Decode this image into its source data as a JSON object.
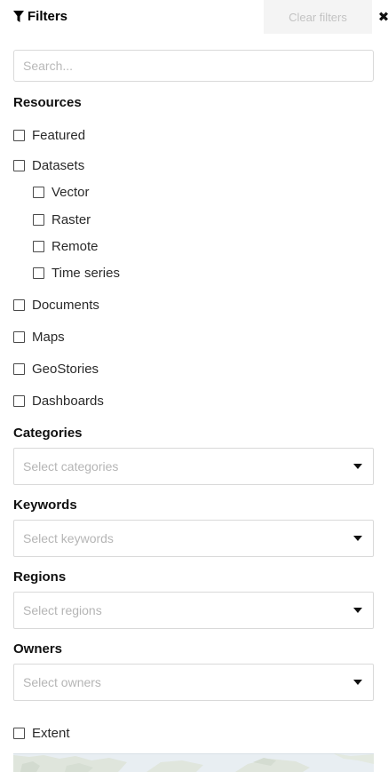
{
  "header": {
    "title": "Filters",
    "clear_label": "Clear filters",
    "close_icon": "close-icon"
  },
  "search": {
    "placeholder": "Search..."
  },
  "resources": {
    "title": "Resources",
    "items": [
      {
        "label": "Featured",
        "checked": false
      },
      {
        "label": "Datasets",
        "checked": false
      },
      {
        "label": "Vector",
        "checked": false
      },
      {
        "label": "Raster",
        "checked": false
      },
      {
        "label": "Remote",
        "checked": false
      },
      {
        "label": "Time series",
        "checked": false
      },
      {
        "label": "Documents",
        "checked": false
      },
      {
        "label": "Maps",
        "checked": false
      },
      {
        "label": "GeoStories",
        "checked": false
      },
      {
        "label": "Dashboards",
        "checked": false
      }
    ]
  },
  "categories": {
    "title": "Categories",
    "placeholder": "Select categories"
  },
  "keywords": {
    "title": "Keywords",
    "placeholder": "Select keywords"
  },
  "regions": {
    "title": "Regions",
    "placeholder": "Select regions"
  },
  "owners": {
    "title": "Owners",
    "placeholder": "Select owners"
  },
  "extent": {
    "label": "Extent",
    "checked": false
  },
  "colors": {
    "clear_bg": "#f4f4f4",
    "clear_text": "#c3c3c3",
    "border": "#d9d9d9",
    "placeholder": "#b5b5b5",
    "map_bg": "#e9eef1"
  }
}
